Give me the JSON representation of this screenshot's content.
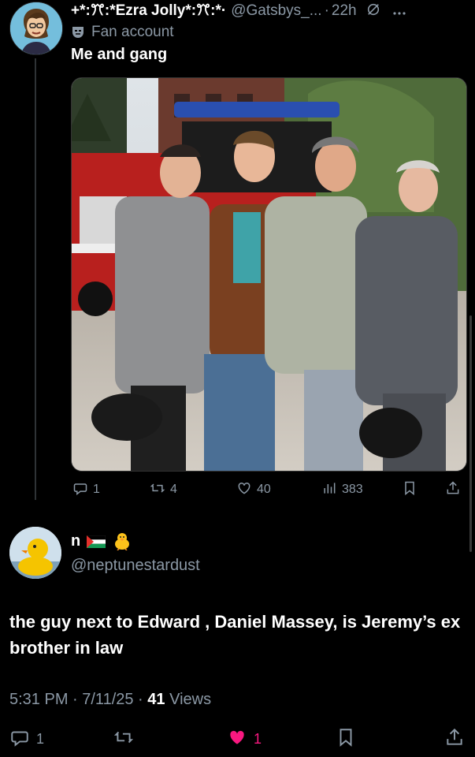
{
  "parent": {
    "display_name": "+*:ꔫ:*Ezra Jolly*:ꔫ:*·",
    "handle": "@Gatsbys_...",
    "separator": "·",
    "time": "22h",
    "label": "Fan account",
    "text": "Me and gang",
    "actions": {
      "replies": "1",
      "reposts": "4",
      "likes": "40",
      "views": "383"
    }
  },
  "reply": {
    "display_name": "n",
    "handle": "@neptunestardust",
    "text": "the guy next to Edward , Daniel Massey, is Jeremy’s ex brother in law",
    "timestamp": "5:31 PM · 7/11/25 · ",
    "views_count": "41",
    "views_label": " Views",
    "actions": {
      "replies": "1",
      "likes": "1"
    }
  },
  "colors": {
    "background": "#000000",
    "text_primary": "#e7e9ea",
    "text_secondary": "#8b98a5",
    "like_active": "#f91880"
  },
  "icons": [
    "fan-account-icon",
    "reply-icon",
    "repost-icon",
    "like-icon",
    "views-icon",
    "bookmark-icon",
    "share-icon",
    "grok-icon",
    "more-icon"
  ]
}
